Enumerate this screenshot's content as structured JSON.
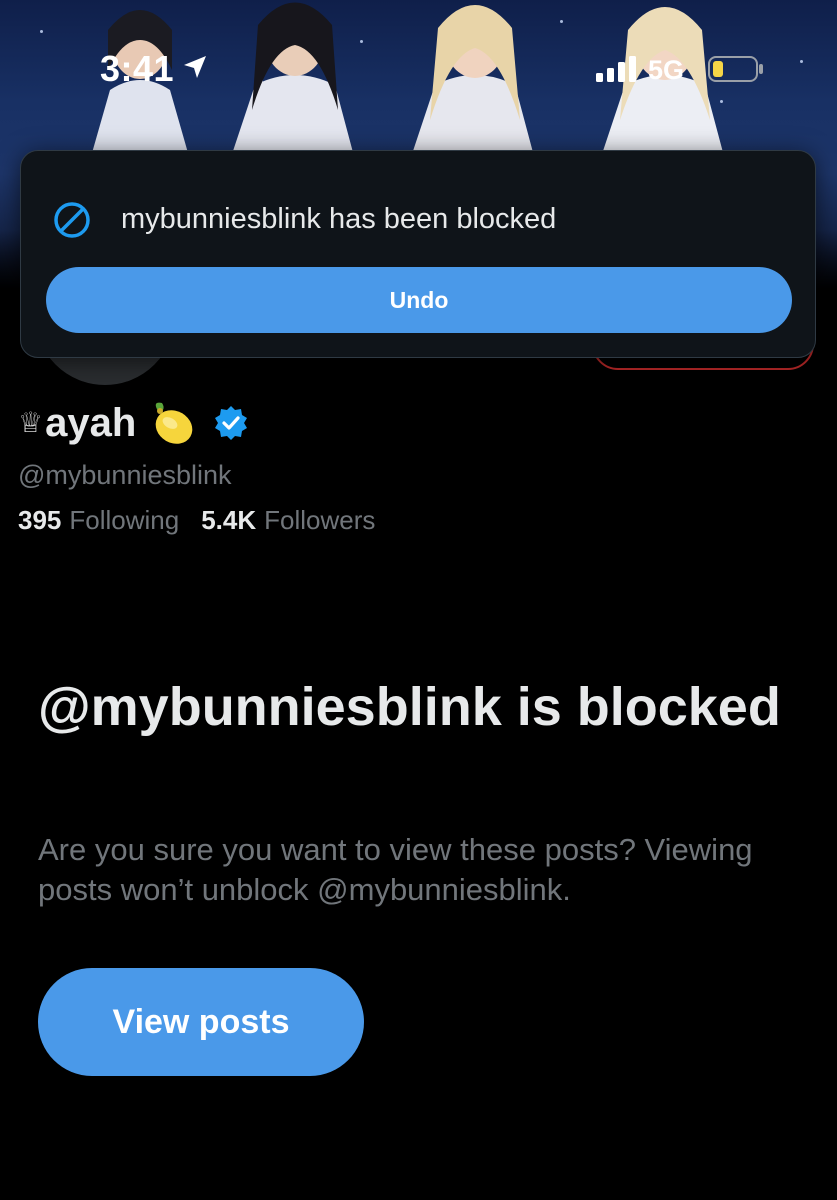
{
  "status_bar": {
    "time": "3:41",
    "network": "5G",
    "icons": [
      "location-arrow-icon",
      "signal-bars-icon",
      "battery-icon"
    ]
  },
  "toast": {
    "icon": "block-icon",
    "message": "mybunniesblink has been blocked",
    "undo_label": "Undo"
  },
  "profile": {
    "crown": "♕",
    "display_name": "ayah",
    "emoji_icon": "lemon-icon",
    "verified_icon": "verified-badge-icon",
    "handle": "@mybunniesblink",
    "following_count": "395",
    "following_label": "Following",
    "followers_count": "5.4K",
    "followers_label": "Followers"
  },
  "blocked": {
    "title": "@mybunniesblink is blocked",
    "description": "Are you sure you want to view these posts? Viewing posts won’t unblock @mybunniesblink.",
    "view_posts_label": "View posts"
  },
  "colors": {
    "accent": "#4a99e9",
    "background": "#000000",
    "muted_text": "#71767b",
    "primary_text": "#e7e9ea",
    "toast_background": "#0f1419"
  }
}
